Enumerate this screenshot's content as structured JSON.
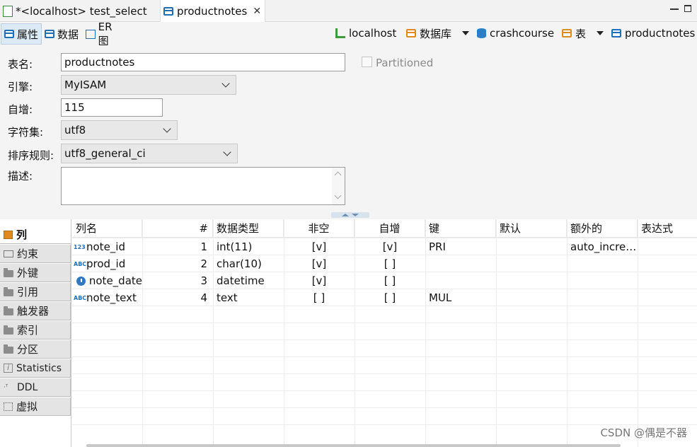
{
  "editor_tabs": [
    {
      "label": "*<localhost> test_select"
    },
    {
      "label": "productnotes"
    }
  ],
  "view_tabs": [
    {
      "label": "属性"
    },
    {
      "label": "数据"
    },
    {
      "label": "ER 图"
    }
  ],
  "breadcrumb": {
    "host": "localhost",
    "db_menu": "数据库",
    "database": "crashcourse",
    "table_menu": "表",
    "table": "productnotes"
  },
  "properties": {
    "name_label": "表名:",
    "name_value": "productnotes",
    "partitioned_label": "Partitioned",
    "engine_label": "引擎:",
    "engine_value": "MyISAM",
    "autoinc_label": "自增:",
    "autoinc_value": "115",
    "charset_label": "字符集:",
    "charset_value": "utf8",
    "collation_label": "排序规则:",
    "collation_value": "utf8_general_ci",
    "desc_label": "描述:",
    "desc_value": ""
  },
  "sidebar": {
    "items": [
      {
        "label": "列",
        "icon": "columns-icon"
      },
      {
        "label": "约束",
        "icon": "constraint-icon"
      },
      {
        "label": "外键",
        "icon": "folder-icon"
      },
      {
        "label": "引用",
        "icon": "folder-icon"
      },
      {
        "label": "触发器",
        "icon": "folder-icon"
      },
      {
        "label": "索引",
        "icon": "folder-icon"
      },
      {
        "label": "分区",
        "icon": "folder-icon"
      },
      {
        "label": "Statistics",
        "icon": "info-icon"
      },
      {
        "label": "DDL",
        "icon": "ddl-icon"
      },
      {
        "label": "虚拟",
        "icon": "virtual-icon"
      }
    ]
  },
  "columns_table": {
    "headers": [
      "列名",
      "#",
      "数据类型",
      "非空",
      "自增",
      "键",
      "默认",
      "额外的",
      "表达式"
    ],
    "rows": [
      {
        "type_icon": "123",
        "name": "note_id",
        "num": "1",
        "dtype": "int(11)",
        "notnull": "[v]",
        "autoinc": "[v]",
        "key": "PRI",
        "default": "",
        "extra": "auto_incre…",
        "expr": ""
      },
      {
        "type_icon": "ABC",
        "name": "prod_id",
        "num": "2",
        "dtype": "char(10)",
        "notnull": "[v]",
        "autoinc": "[ ]",
        "key": "",
        "default": "",
        "extra": "",
        "expr": ""
      },
      {
        "type_icon": "clock",
        "name": "note_date",
        "num": "3",
        "dtype": "datetime",
        "notnull": "[v]",
        "autoinc": "[ ]",
        "key": "",
        "default": "",
        "extra": "",
        "expr": ""
      },
      {
        "type_icon": "ABC",
        "name": "note_text",
        "num": "4",
        "dtype": "text",
        "notnull": "[ ]",
        "autoinc": "[ ]",
        "key": "MUL",
        "default": "",
        "extra": "",
        "expr": ""
      }
    ]
  },
  "watermark": "CSDN @偶是不器",
  "colors": {
    "accent": "#1f6fb8",
    "orange": "#e08a1e",
    "active_tab": "#dceaf6"
  }
}
